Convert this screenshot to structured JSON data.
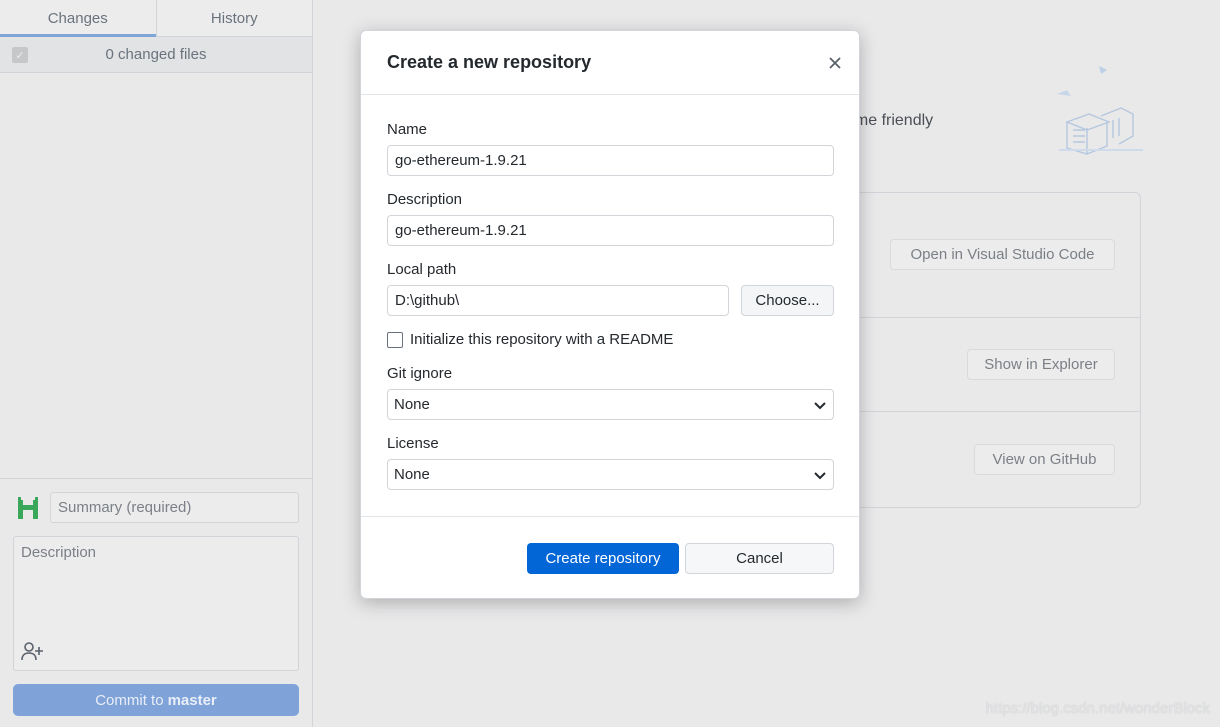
{
  "sidebar": {
    "tabs": [
      {
        "label": "Changes",
        "active": true
      },
      {
        "label": "History",
        "active": false
      }
    ],
    "changes_count": "0 changed files",
    "commit": {
      "summary_placeholder": "Summary (required)",
      "description_placeholder": "Description",
      "button_prefix": "Commit to",
      "branch": "master"
    }
  },
  "main": {
    "friendly_text": "ome friendly",
    "buttons": {
      "open_editor": "Open in Visual Studio Code",
      "show_explorer": "Show in Explorer",
      "view_github": "View on GitHub"
    }
  },
  "dialog": {
    "title": "Create a new repository",
    "name_label": "Name",
    "name_value": "go-ethereum-1.9.21",
    "description_label": "Description",
    "description_value": "go-ethereum-1.9.21",
    "path_label": "Local path",
    "path_value": "D:\\github\\",
    "choose_label": "Choose...",
    "readme_label": "Initialize this repository with a README",
    "gitignore_label": "Git ignore",
    "gitignore_value": "None",
    "license_label": "License",
    "license_value": "None",
    "create_label": "Create repository",
    "cancel_label": "Cancel"
  },
  "watermark": "https://blog.csdn.net/wonderBlock",
  "colors": {
    "primary": "#0366d6",
    "commit_disabled": "#7fa2d8",
    "overlay_bg": "#e9e9ea"
  }
}
